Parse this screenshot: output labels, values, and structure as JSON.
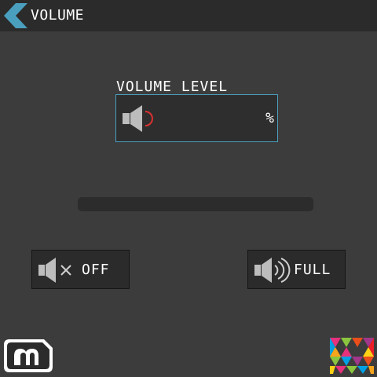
{
  "header": {
    "title": "VOLUME",
    "back_icon": "chevron-left-icon"
  },
  "volume": {
    "label": "VOLUME LEVEL",
    "value": "",
    "unit": "%",
    "icon": "speaker-low-icon",
    "level_fraction": 0
  },
  "buttons": {
    "off_label": "OFF",
    "off_icon": "speaker-mute-icon",
    "full_label": "FULL",
    "full_icon": "speaker-full-icon"
  },
  "colors": {
    "accent": "#4a9fbf",
    "indicator": "#d93030",
    "background": "#3c3c3c",
    "header": "#2b2b2b"
  },
  "logos": {
    "left": "m-logo-icon",
    "right": "colorful-logo-icon"
  }
}
